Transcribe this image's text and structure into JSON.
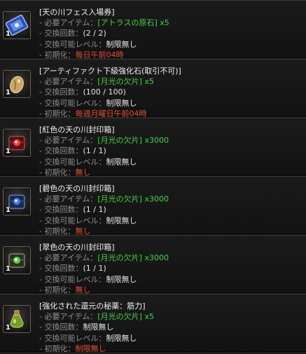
{
  "items": [
    {
      "title": "[天の川フェス入場券]",
      "icon": "ticket-icon",
      "count": "1",
      "req_label": "- 必要アイテム：",
      "req_item": "[アトラスの原石]",
      "req_qty": " x5",
      "exch_label": "- 交換回数：",
      "exch_value": "(2 / 2)",
      "level_label": "- 交換可能レベル：",
      "level_value": "制限無し",
      "reset_label": "- 初期化：",
      "reset_value": "毎日午前04時"
    },
    {
      "title": "[アーティファクト下級強化石(取引不可)]",
      "icon": "enhancement-stone-icon",
      "count": "1",
      "req_label": "- 必要アイテム：",
      "req_item": "[月光の欠片]",
      "req_qty": " x5",
      "exch_label": "- 交換回数：",
      "exch_value": "(100 / 100)",
      "level_label": "- 交換可能レベル：",
      "level_value": "制限無し",
      "reset_label": "- 初期化：",
      "reset_value": "毎週月曜日午前04時"
    },
    {
      "title": "[紅色の天の川封印箱]",
      "icon": "red-sealed-box-icon",
      "count": "1",
      "req_label": "- 必要アイテム：",
      "req_item": "[月光の欠片]",
      "req_qty": " x3000",
      "exch_label": "- 交換回数：",
      "exch_value": "(1 / 1)",
      "level_label": "- 交換可能レベル：",
      "level_value": "制限無し",
      "reset_label": "- 初期化：",
      "reset_value": "無し"
    },
    {
      "title": "[碧色の天の川封印箱]",
      "icon": "blue-sealed-box-icon",
      "count": "1",
      "req_label": "- 必要アイテム：",
      "req_item": "[月光の欠片]",
      "req_qty": " x3000",
      "exch_label": "- 交換回数：",
      "exch_value": "(1 / 1)",
      "level_label": "- 交換可能レベル：",
      "level_value": "制限無し",
      "reset_label": "- 初期化：",
      "reset_value": "無し"
    },
    {
      "title": "[翠色の天の川封印箱]",
      "icon": "green-sealed-box-icon",
      "count": "1",
      "req_label": "- 必要アイテム：",
      "req_item": "[月光の欠片]",
      "req_qty": " x3000",
      "exch_label": "- 交換回数：",
      "exch_value": "(1 / 1)",
      "level_label": "- 交換可能レベル：",
      "level_value": "制限無し",
      "reset_label": "- 初期化：",
      "reset_value": "無し"
    },
    {
      "title": "[強化された還元の秘薬：筋力]",
      "icon": "potion-icon",
      "count": "1",
      "req_label": "- 必要アイテム：",
      "req_item": "[月光の欠片]",
      "req_qty": " x5",
      "exch_label": "- 交換回数：",
      "exch_value": "制限無し",
      "level_label": "- 交換可能レベル：",
      "level_value": "制限無し",
      "reset_label": "- 初期化：",
      "reset_value": "制限無し"
    }
  ],
  "colors": {
    "white": "#e6e6e6",
    "green": "#46d246",
    "red": "#e04e36",
    "label": "#8f8f8f"
  }
}
